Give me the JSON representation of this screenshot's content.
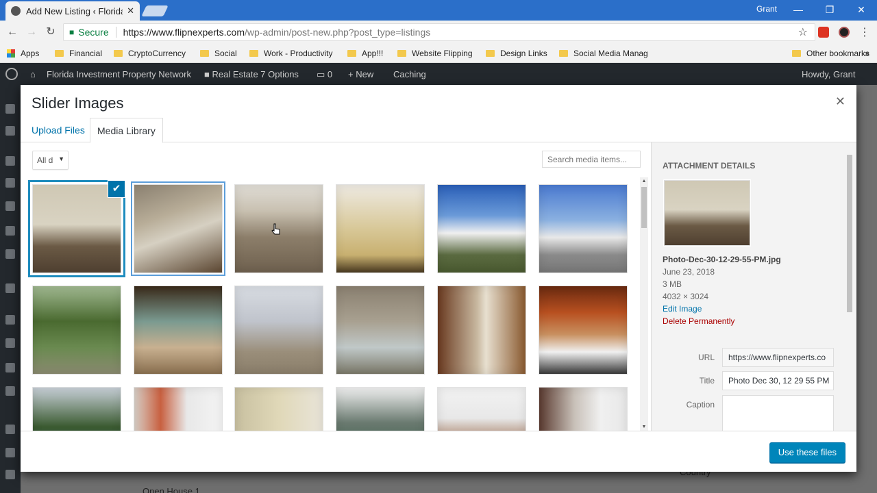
{
  "browser": {
    "tab_title": "Add New Listing ‹ Florida",
    "user": "Grant",
    "secure_label": "Secure",
    "url_host": "https://www.flipnexperts.com",
    "url_path": "/wp-admin/post-new.php?post_type=listings"
  },
  "bookmarks": {
    "items": [
      "Apps",
      "Financial",
      "CryptoCurrency",
      "Social",
      "Work - Productivity",
      "App!!!",
      "Website Flipping",
      "Design Links",
      "Social Media Manag",
      "Other bookmarks"
    ]
  },
  "adminbar": {
    "site": "Florida Investment Property Network",
    "options": "Real Estate 7 Options",
    "comments": "0",
    "new": "New",
    "caching": "Caching",
    "howdy": "Howdy, Grant"
  },
  "modal": {
    "title": "Slider Images",
    "tabs": {
      "upload": "Upload Files",
      "library": "Media Library"
    },
    "filter_value": "All d",
    "search_placeholder": "Search media items...",
    "use_button": "Use these files"
  },
  "details": {
    "heading": "ATTACHMENT DETAILS",
    "filename": "Photo-Dec-30-12-29-55-PM.jpg",
    "date": "June 23, 2018",
    "size": "3 MB",
    "dimensions": "4032 × 3024",
    "edit_link": "Edit Image",
    "delete_link": "Delete Permanently",
    "url_label": "URL",
    "url_value": "https://www.flipnexperts.co",
    "title_label": "Title",
    "title_value": "Photo Dec 30, 12 29 55 PM",
    "caption_label": "Caption"
  },
  "background": {
    "country": "Country",
    "open_house": "Open House 1"
  }
}
